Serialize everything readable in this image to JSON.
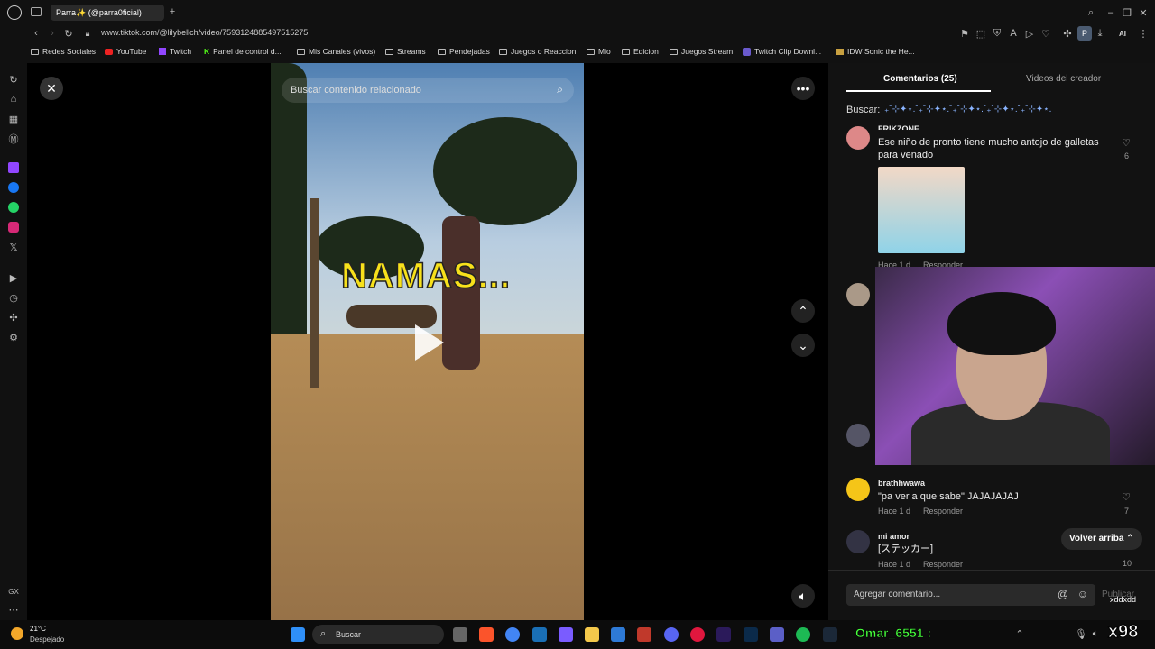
{
  "browser": {
    "tab_title": "Parra✨ (@parra0ficial)",
    "url": "www.tiktok.com/@lilybellch/video/7593124885497515275",
    "ai_label": "AI",
    "profile_initial": "P"
  },
  "bookmarks": [
    "Redes Sociales",
    "YouTube",
    "Twitch",
    "Panel de control d...",
    "Mis Canales (vivos)",
    "Streams",
    "Pendejadas",
    "Juegos o Reaccion",
    "Mio",
    "Edicion",
    "Juegos Stream",
    "Twitch Clip Downl...",
    "IDW Sonic the He..."
  ],
  "video": {
    "search_placeholder": "Buscar contenido relacionado",
    "caption": "NAMAS...",
    "close_icon": "close-icon",
    "more_icon": "more-icon"
  },
  "panel": {
    "tab_comments": "Comentarios (25)",
    "tab_videos": "Videos del creador",
    "search_label": "Buscar:",
    "search_value": "₊˚⊹✦⋆.˚₊˚⊹✦⋆.˚₊˚⊹✦⋆.˚₊˚⊹✦⋆.˚₊˚⊹✦⋆.",
    "comments": [
      {
        "user": "FRIKZONE",
        "text": "Ese niño de pronto tiene mucho antojo de galletas para venado",
        "time": "Hace 1 d",
        "reply": "Responder",
        "likes": "6"
      },
      {
        "user": "brathhwawa",
        "text": "\"pa ver a que sabe\" JAJAJAJAJ",
        "time": "Hace 1 d",
        "reply": "Responder",
        "likes": "7"
      },
      {
        "user": "mi amor",
        "text": "[ステッカー]",
        "time": "Hace 1 d",
        "reply": "Responder",
        "likes": "10"
      }
    ],
    "back_to_top": "Volver arriba",
    "add_comment": "Agregar comentario...",
    "publish": "Publicar"
  },
  "overlay": {
    "chat_user": "Omar_6551 :",
    "chat_badge": "xddxdd",
    "chat_num": "x98"
  },
  "taskbar": {
    "weather_temp": "21°C",
    "weather_desc": "Despejado",
    "search": "Buscar",
    "left_label": "GX"
  }
}
